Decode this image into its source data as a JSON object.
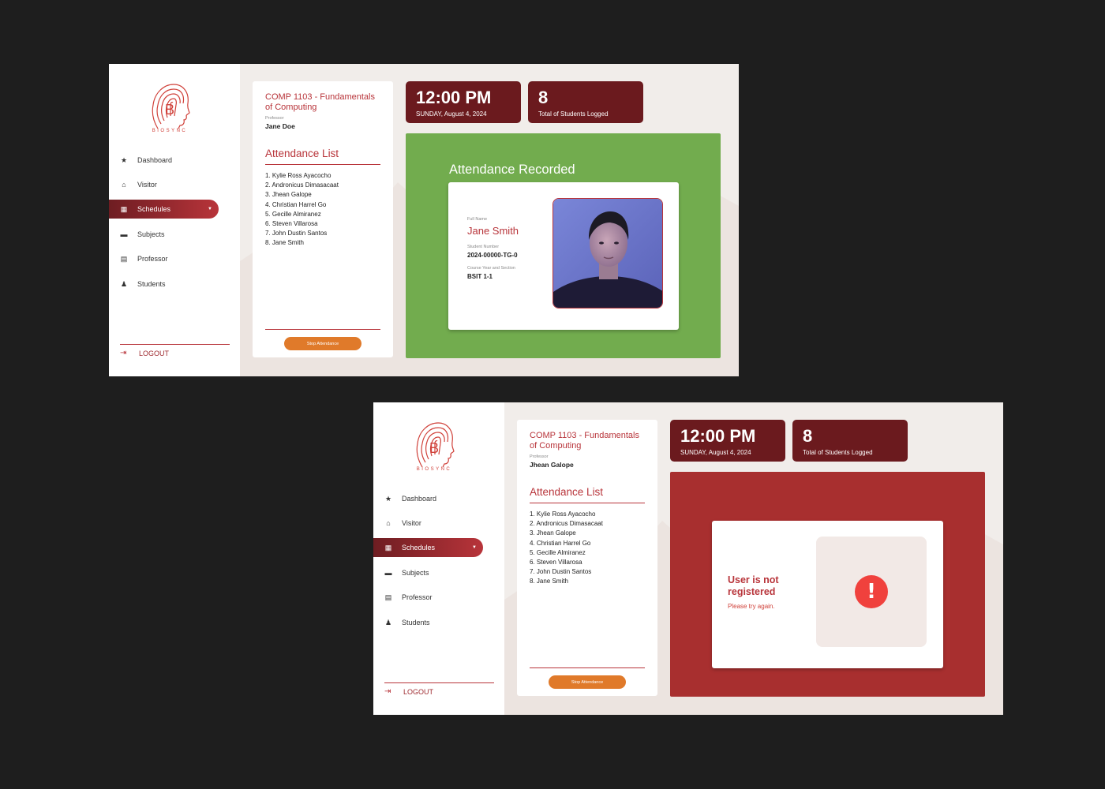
{
  "screens": [
    {
      "logo_text": "BIOSYNC",
      "nav": [
        {
          "label": "Dashboard",
          "icon": "★"
        },
        {
          "label": "Visitor",
          "icon": "⌂"
        },
        {
          "label": "Schedules",
          "icon": "▦"
        },
        {
          "label": "Subjects",
          "icon": "▬"
        },
        {
          "label": "Professor",
          "icon": "▤"
        },
        {
          "label": "Students",
          "icon": "♟"
        }
      ],
      "logout_label": "LOGOUT",
      "logout_icon": "⇥",
      "course_title": "COMP 1103  - Fundamentals of Computing",
      "professor_label": "Professor",
      "professor_name": "Jane Doe",
      "attendance_title": "Attendance List",
      "attendance": [
        "1. Kylie Ross Ayacocho",
        "2. Andronicus Dimasacaat",
        "3. Jhean Galope",
        "4. Christian Harrel Go",
        "5. Gecille Almiranez",
        "6. Steven Villarosa",
        "7. John Dustin Santos",
        "8. Jane Smith"
      ],
      "stop_button": "Stop Attendance",
      "time": "12:00 PM",
      "date": "SUNDAY, August 4, 2024",
      "student_count": "8",
      "student_count_label": "Total of Students Logged",
      "panel_heading": "Attendance Recorded",
      "full_name_label": "Full Name",
      "full_name": "Jane Smith",
      "student_number_label": "Student Number",
      "student_number": "2024-00000-TG-0",
      "course_section_label": "Course Year and Section",
      "course_section": "BSIT 1-1"
    },
    {
      "logo_text": "BIOSYNC",
      "nav": [
        {
          "label": "Dashboard",
          "icon": "★"
        },
        {
          "label": "Visitor",
          "icon": "⌂"
        },
        {
          "label": "Schedules",
          "icon": "▦"
        },
        {
          "label": "Subjects",
          "icon": "▬"
        },
        {
          "label": "Professor",
          "icon": "▤"
        },
        {
          "label": "Students",
          "icon": "♟"
        }
      ],
      "logout_label": "LOGOUT",
      "logout_icon": "⇥",
      "course_title": "COMP 1103  - Fundamentals of Computing",
      "professor_label": "Professor",
      "professor_name": "Jhean Galope",
      "attendance_title": "Attendance List",
      "attendance": [
        "1. Kylie Ross Ayacocho",
        "2. Andronicus Dimasacaat",
        "3. Jhean Galope",
        "4. Christian Harrel Go",
        "5. Gecille Almiranez",
        "6. Steven Villarosa",
        "7. John Dustin Santos",
        "8. Jane Smith"
      ],
      "stop_button": "Stop Attendance",
      "time": "12:00 PM",
      "date": "SUNDAY, August 4, 2024",
      "student_count": "8",
      "student_count_label": "Total of Students Logged",
      "error_title": "User is not registered",
      "error_subtitle": "Please try again.",
      "error_icon": "!"
    }
  ]
}
